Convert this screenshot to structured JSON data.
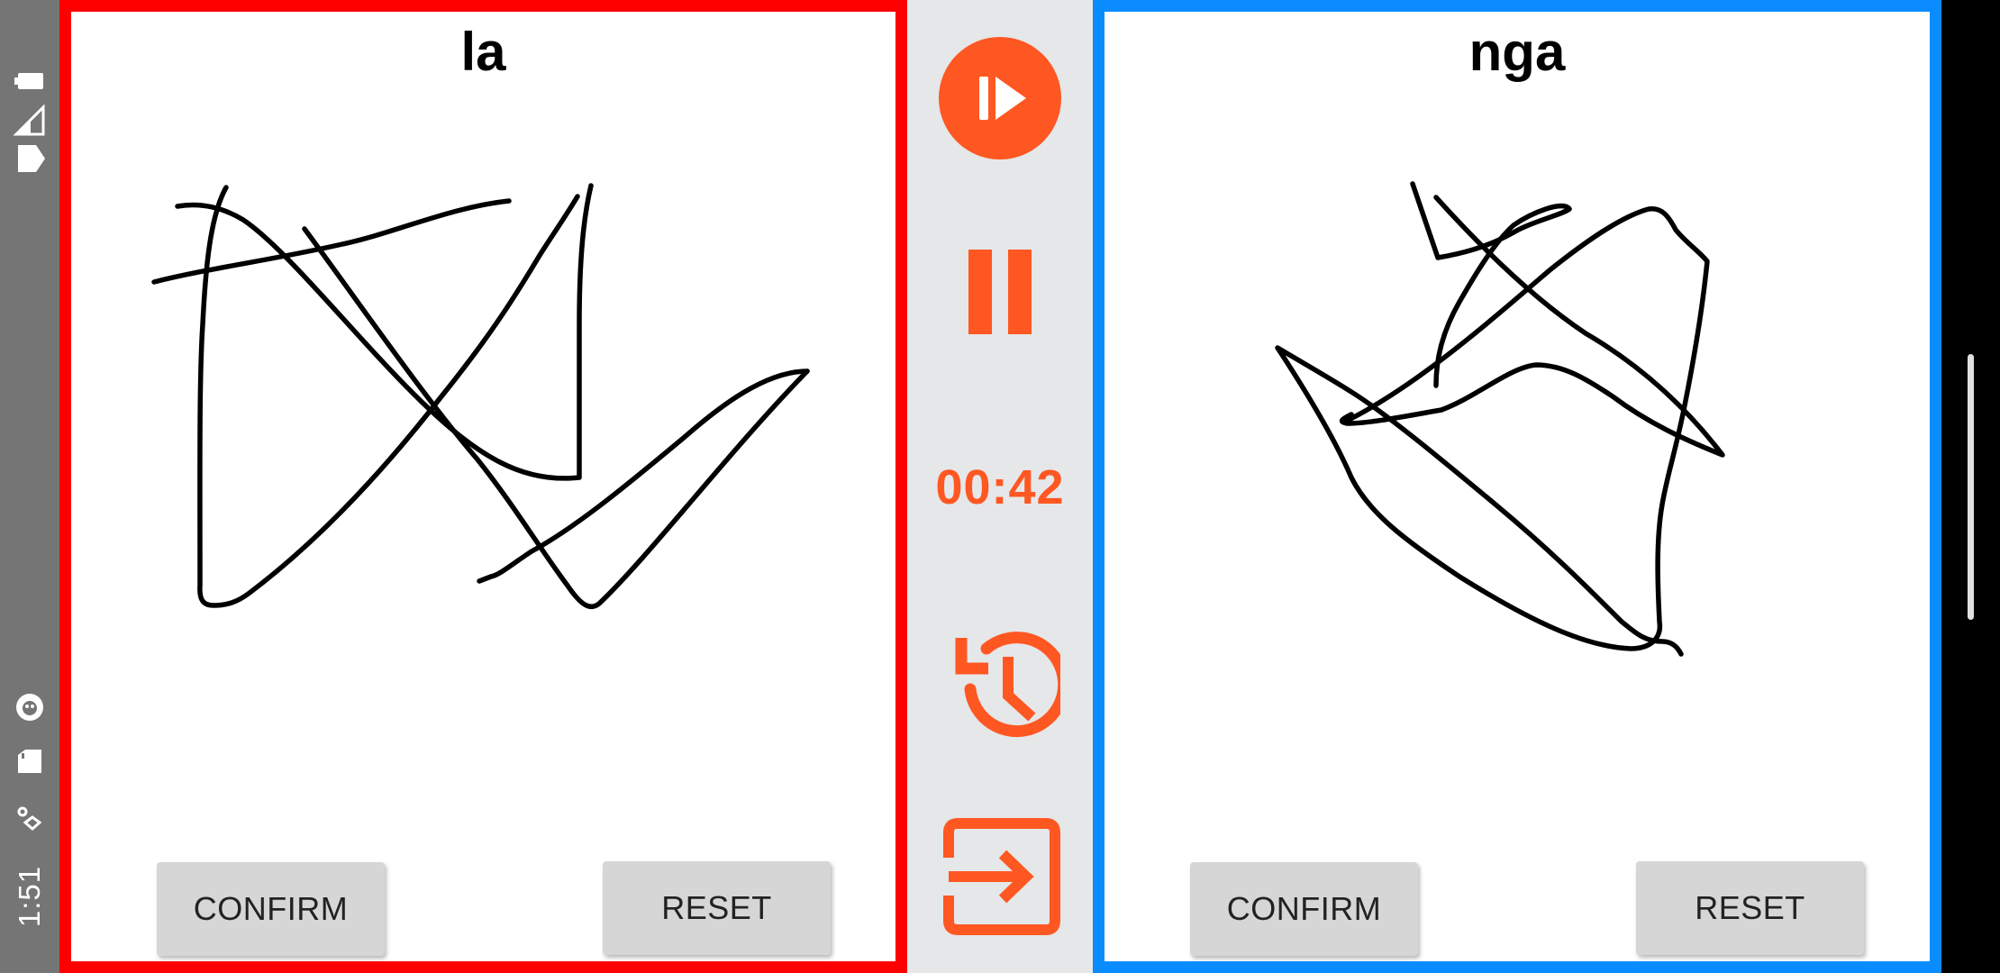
{
  "status_bar": {
    "time": "1:51",
    "icons": [
      "battery-icon",
      "signal-icon",
      "wifi-icon",
      "notification-icon",
      "sd-card-icon",
      "location-icon"
    ]
  },
  "colors": {
    "accent": "#ff5722",
    "left_border": "#ff0000",
    "right_border": "#0a8cff",
    "stroke": "#000000",
    "button_bg": "#d6d6d6",
    "controls_bg": "#e5e7e9"
  },
  "left_panel": {
    "title": "la",
    "confirm_label": "CONFIRM",
    "reset_label": "RESET"
  },
  "right_panel": {
    "title": "nga",
    "confirm_label": "CONFIRM",
    "reset_label": "RESET"
  },
  "controls": {
    "play_icon": "play-next-icon",
    "pause_icon": "pause-icon",
    "timer": "00:42",
    "history_icon": "history-icon",
    "exit_icon": "exit-icon"
  }
}
